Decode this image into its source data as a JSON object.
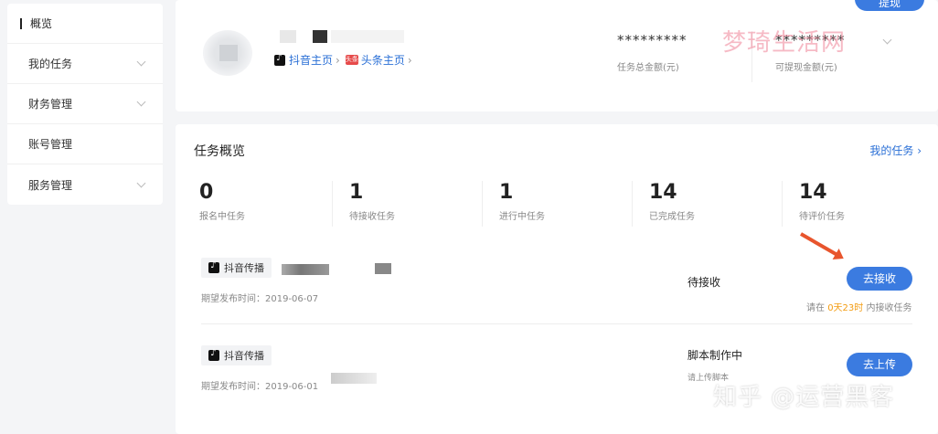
{
  "sidebar": {
    "items": [
      {
        "label": "概览"
      },
      {
        "label": "我的任务"
      },
      {
        "label": "财务管理"
      },
      {
        "label": "账号管理"
      },
      {
        "label": "服务管理"
      }
    ]
  },
  "profile": {
    "withdraw_button": "提现",
    "douyin_link": "抖音主页",
    "toutiao_link": "头条主页",
    "toutiao_icon_text": "头条",
    "total_amount_value": "*********",
    "total_amount_label": "任务总金额(元)",
    "withdrawable_value": "*********",
    "withdrawable_label": "可提现金额(元)"
  },
  "overview": {
    "title": "任务概览",
    "my_tasks_link": "我的任务",
    "stats": [
      {
        "value": "0",
        "label": "报名中任务"
      },
      {
        "value": "1",
        "label": "待接收任务"
      },
      {
        "value": "1",
        "label": "进行中任务"
      },
      {
        "value": "14",
        "label": "已完成任务"
      },
      {
        "value": "14",
        "label": "待评价任务"
      }
    ],
    "tasks": [
      {
        "platform": "抖音传播",
        "publish_time": "期望发布时间：2019-06-07",
        "status": "待接收",
        "action": "去接收",
        "deadline_prefix": "请在 ",
        "deadline_highlight": "0天23时",
        "deadline_suffix": " 内接收任务"
      },
      {
        "platform": "抖音传播",
        "publish_time": "期望发布时间：2019-06-01",
        "status": "脚本制作中",
        "substatus": "请上传脚本",
        "action": "去上传"
      }
    ]
  },
  "watermarks": {
    "top": "梦琦生活网",
    "bottom": "知乎 @运营黑客"
  },
  "colors": {
    "accent": "#3b7be0",
    "link": "#2a6fd6",
    "highlight": "#f39c12",
    "arrow": "#e8552d"
  }
}
